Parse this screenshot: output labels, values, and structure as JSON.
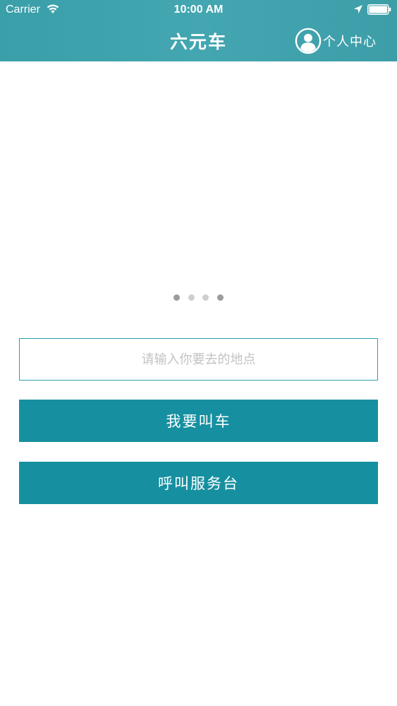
{
  "status_bar": {
    "carrier": "Carrier",
    "time": "10:00 AM",
    "icons": [
      "wifi-icon",
      "location-arrow-icon",
      "battery-icon"
    ]
  },
  "nav": {
    "title": "六元车",
    "profile_label": "个人中心",
    "profile_icon": "user-avatar-icon"
  },
  "carousel": {
    "page_count": 4,
    "active_pages": [
      0,
      3
    ]
  },
  "destination": {
    "placeholder": "请输入你要去的地点",
    "value": ""
  },
  "buttons": {
    "call_car": "我要叫车",
    "call_service_desk": "呼叫服务台"
  },
  "colors": {
    "header": "#43a6b1",
    "button": "#1690a1",
    "input_border": "#2c9fb0",
    "dot_active": "#9c9c9c",
    "dot_inactive": "#cfcfcf"
  }
}
